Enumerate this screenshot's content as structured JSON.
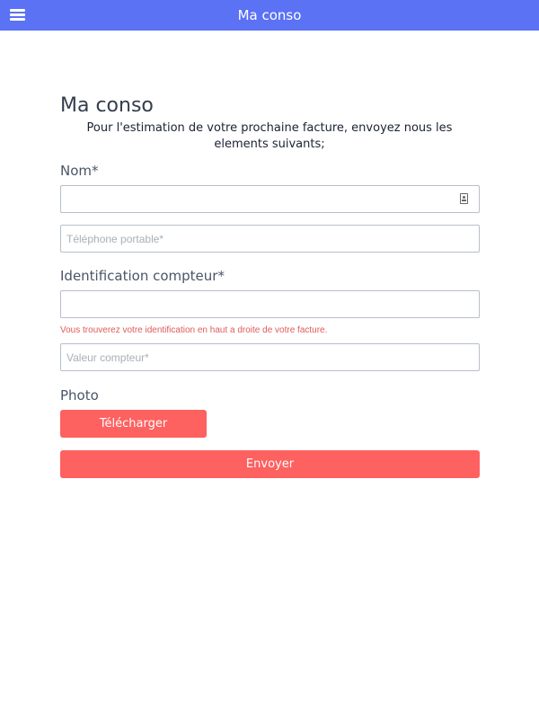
{
  "app_bar": {
    "title": "Ma conso",
    "menu_icon": "hamburger-menu-icon",
    "background_color": "#5b72f5"
  },
  "form": {
    "title": "Ma conso",
    "intro": "Pour l'estimation de votre prochaine facture, envoyez nous les elements suivants;",
    "name_label": "Nom*",
    "name_value": "",
    "name_icon": "contact-card-icon",
    "phone_placeholder": "Téléphone portable*",
    "meter_id_label": "Identification compteur*",
    "meter_id_value": "",
    "meter_id_hint": "Vous trouverez votre identification en haut a droite de votre facture.",
    "meter_value_placeholder": "Valeur compteur*",
    "photo_label": "Photo",
    "upload_label": "Télécharger",
    "submit_label": "Envoyer",
    "accent_color": "#fd6160",
    "hint_color": "#e05a5a"
  }
}
